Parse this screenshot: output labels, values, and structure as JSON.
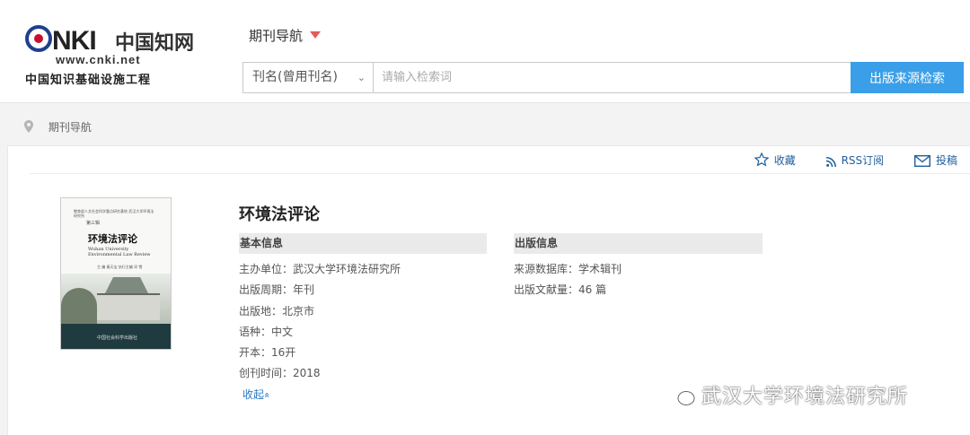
{
  "header": {
    "logo": {
      "brand": "CNKI",
      "cn_name": "中国知网",
      "url": "www.cnki.net",
      "tagline": "中国知识基础设施工程"
    },
    "nav_title": "期刊导航",
    "search": {
      "field_selected": "刊名(曾用刊名)",
      "placeholder": "请输入检索词",
      "button_label": "出版来源检索"
    }
  },
  "breadcrumb": {
    "current": "期刊导航"
  },
  "actions": {
    "favorite": "收藏",
    "rss": "RSS订阅",
    "submit": "投稿"
  },
  "cover": {
    "header_text": "教育部人文社会科学重点研究基地 武汉大学环境法研究所",
    "volume": "第三辑",
    "title": "环境法评论",
    "en_title": "Wuhan University Environmental Law Review",
    "editor": "主 编 秦天宝  执行主编 邓 雪",
    "publisher": "中国社会科学出版社"
  },
  "journal": {
    "title": "环境法评论",
    "basic_info": {
      "heading": "基本信息",
      "rows": [
        {
          "label": "主办单位：",
          "value": "武汉大学环境法研究所"
        },
        {
          "label": "出版周期：",
          "value": "年刊"
        },
        {
          "label": "出版地：",
          "value": "北京市"
        },
        {
          "label": "语种：",
          "value": "中文"
        },
        {
          "label": "开本：",
          "value": "16开"
        },
        {
          "label": "创刊时间：",
          "value": "2018"
        }
      ]
    },
    "publish_info": {
      "heading": "出版信息",
      "rows": [
        {
          "label": "来源数据库：",
          "value": "学术辑刊"
        },
        {
          "label": "出版文献量：",
          "value": "46 篇"
        }
      ]
    },
    "collapse_label": "收起",
    "collapse_icon": "«"
  },
  "watermark": {
    "text": "武汉大学环境法研究所",
    "icon": "wechat-icon"
  },
  "colors": {
    "accent_blue": "#3a9fe8",
    "link_blue": "#1f5e9c",
    "caret_red": "#e45b57"
  }
}
